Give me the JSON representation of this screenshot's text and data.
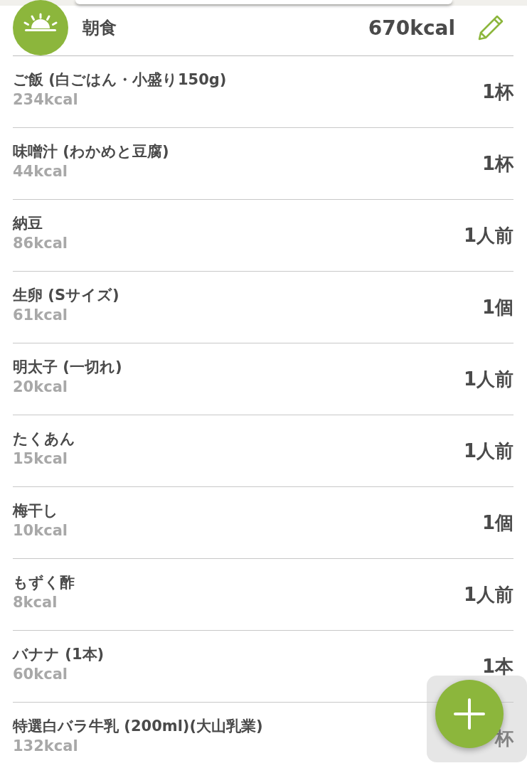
{
  "meal": {
    "title": "朝食",
    "total": "670kcal"
  },
  "items": [
    {
      "name": "ご飯 (白ごはん・小盛り150g)",
      "kcal": "234kcal",
      "unit": "1杯"
    },
    {
      "name": "味噌汁 (わかめと豆腐)",
      "kcal": "44kcal",
      "unit": "1杯"
    },
    {
      "name": "納豆",
      "kcal": "86kcal",
      "unit": "1人前"
    },
    {
      "name": "生卵 (Sサイズ)",
      "kcal": "61kcal",
      "unit": "1個"
    },
    {
      "name": "明太子 (一切れ)",
      "kcal": "20kcal",
      "unit": "1人前"
    },
    {
      "name": "たくあん",
      "kcal": "15kcal",
      "unit": "1人前"
    },
    {
      "name": "梅干し",
      "kcal": "10kcal",
      "unit": "1個"
    },
    {
      "name": "もずく酢",
      "kcal": "8kcal",
      "unit": "1人前"
    },
    {
      "name": "バナナ (1本)",
      "kcal": "60kcal",
      "unit": "1本"
    },
    {
      "name": "特選白バラ牛乳 (200ml)(大山乳業)",
      "kcal": "132kcal",
      "unit": "杯"
    }
  ]
}
